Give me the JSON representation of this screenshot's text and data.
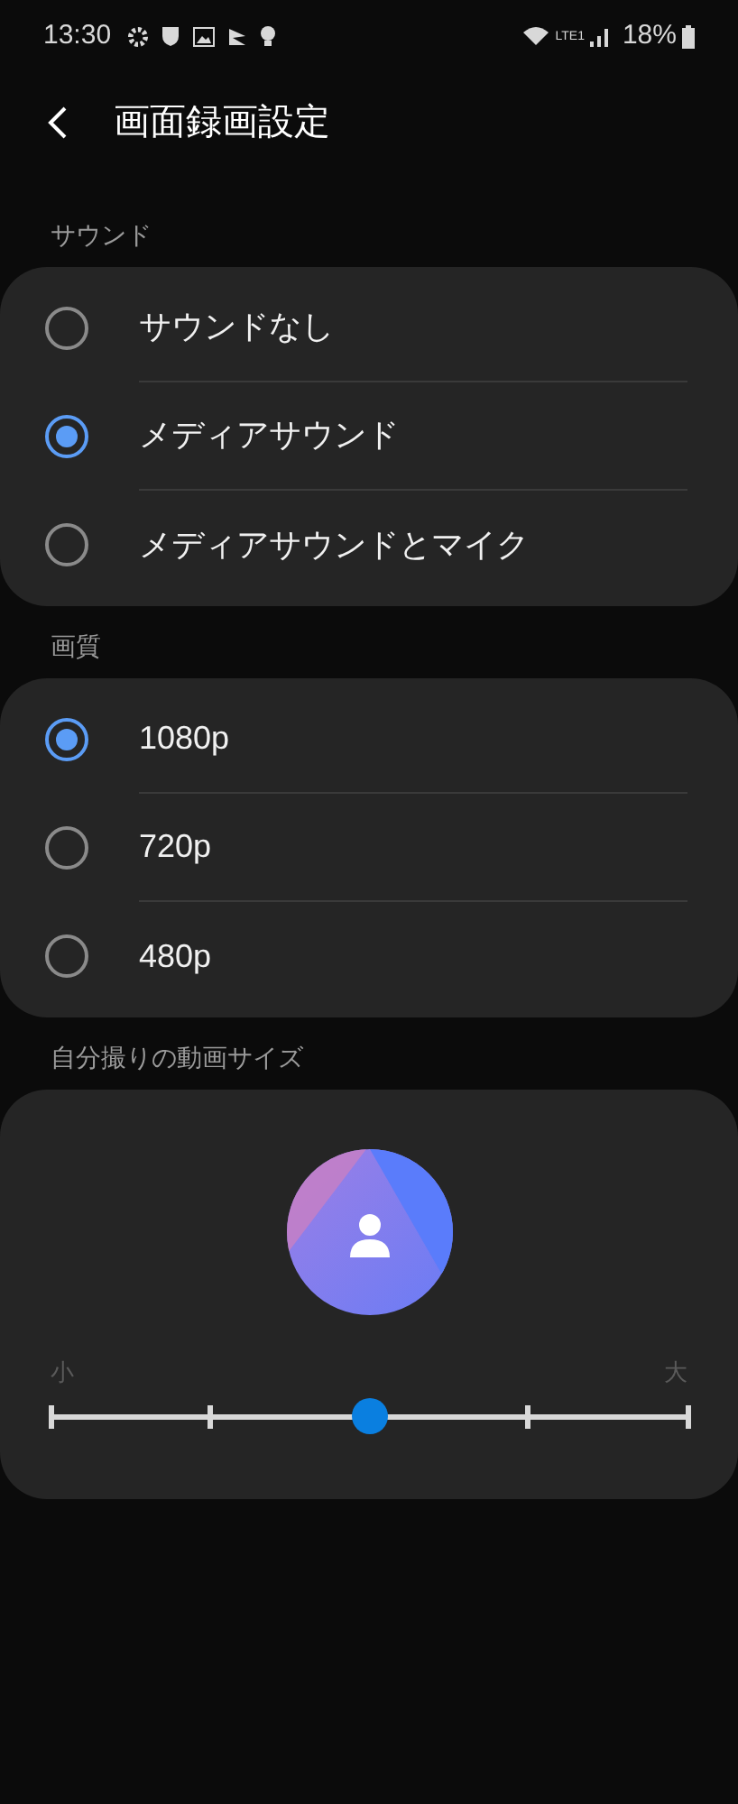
{
  "status_bar": {
    "time": "13:30",
    "network_label": "LTE1",
    "battery": "18%"
  },
  "header": {
    "title": "画面録画設定"
  },
  "sections": [
    {
      "label": "サウンド",
      "kind": "radio",
      "options": [
        {
          "label": "サウンドなし",
          "selected": false
        },
        {
          "label": "メディアサウンド",
          "selected": true
        },
        {
          "label": "メディアサウンドとマイク",
          "selected": false
        }
      ]
    },
    {
      "label": "画質",
      "kind": "radio",
      "options": [
        {
          "label": "1080p",
          "selected": true
        },
        {
          "label": "720p",
          "selected": false
        },
        {
          "label": "480p",
          "selected": false
        }
      ]
    },
    {
      "label": "自分撮りの動画サイズ",
      "kind": "slider",
      "min_label": "小",
      "max_label": "大",
      "level": 0.5
    }
  ]
}
